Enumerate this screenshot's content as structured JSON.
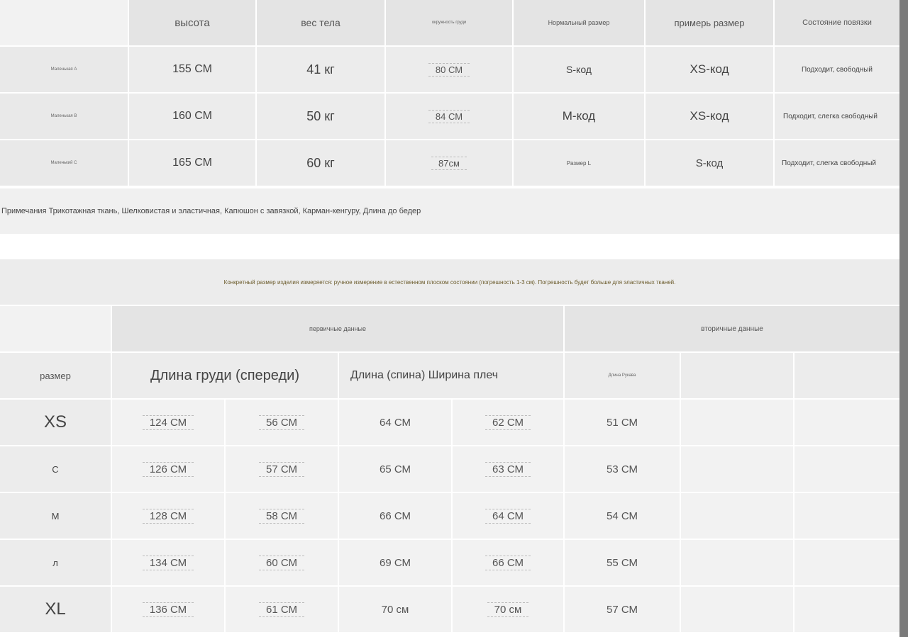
{
  "table1": {
    "headers": [
      "высота",
      "вес тела",
      "окружность груди",
      "Нормальный размер",
      "примерь размер",
      "Состояние повязки"
    ],
    "rows": [
      {
        "label": "Маленькая A",
        "height": "155 СМ",
        "weight": "41 кг",
        "chest": "80 СМ",
        "normal": "S-код",
        "tried": "XS-код",
        "fit": "Подходит, свободный"
      },
      {
        "label": "Маленькая B",
        "height": "160 СМ",
        "weight": "50 кг",
        "chest": "84 СМ",
        "normal": "M-код",
        "tried": "XS-код",
        "fit": "Подходит, слегка свободный"
      },
      {
        "label": "Маленький C",
        "height": "165 СМ",
        "weight": "60 кг",
        "chest": "87см",
        "normal": "Размер L",
        "tried": "S-код",
        "fit": "Подходит, слегка свободный"
      }
    ],
    "note": "Примечания Трикотажная ткань, Шелковистая и эластичная, Капюшон с завязкой, Карман-кенгуру, Длина до бедер"
  },
  "measure_note": "Конкретный размер изделия измеряется: ручное измерение в естественном плоском состоянии (погрешность 1-3 см). Погрешность будет больше для эластичных тканей.",
  "table2": {
    "group_primary": "первичные данные",
    "group_secondary": "вторичные данные",
    "size_header": "размер",
    "header_chest": "Длина груди (спереди)",
    "header_back_shoulder": "Длина (спина) Ширина плеч",
    "header_sleeve": "Длина Рукава",
    "rows": [
      {
        "size": "XS",
        "c1": "124 СМ",
        "c2": "56 СМ",
        "c3": "64 СМ",
        "c4": "62 СМ",
        "c5": "51 СМ"
      },
      {
        "size": "С",
        "c1": "126 СМ",
        "c2": "57 СМ",
        "c3": "65 СМ",
        "c4": "63 СМ",
        "c5": "53 СМ"
      },
      {
        "size": "М",
        "c1": "128 СМ",
        "c2": "58 СМ",
        "c3": "66 СМ",
        "c4": "64 СМ",
        "c5": "54 СМ"
      },
      {
        "size": "л",
        "c1": "134 СМ",
        "c2": "60 СМ",
        "c3": "69 СМ",
        "c4": "66 СМ",
        "c5": "55 СМ"
      },
      {
        "size": "XL",
        "c1": "136 СМ",
        "c2": "61 СМ",
        "c3": "70 см",
        "c4": "70 см",
        "c5": "57 СМ"
      }
    ]
  }
}
